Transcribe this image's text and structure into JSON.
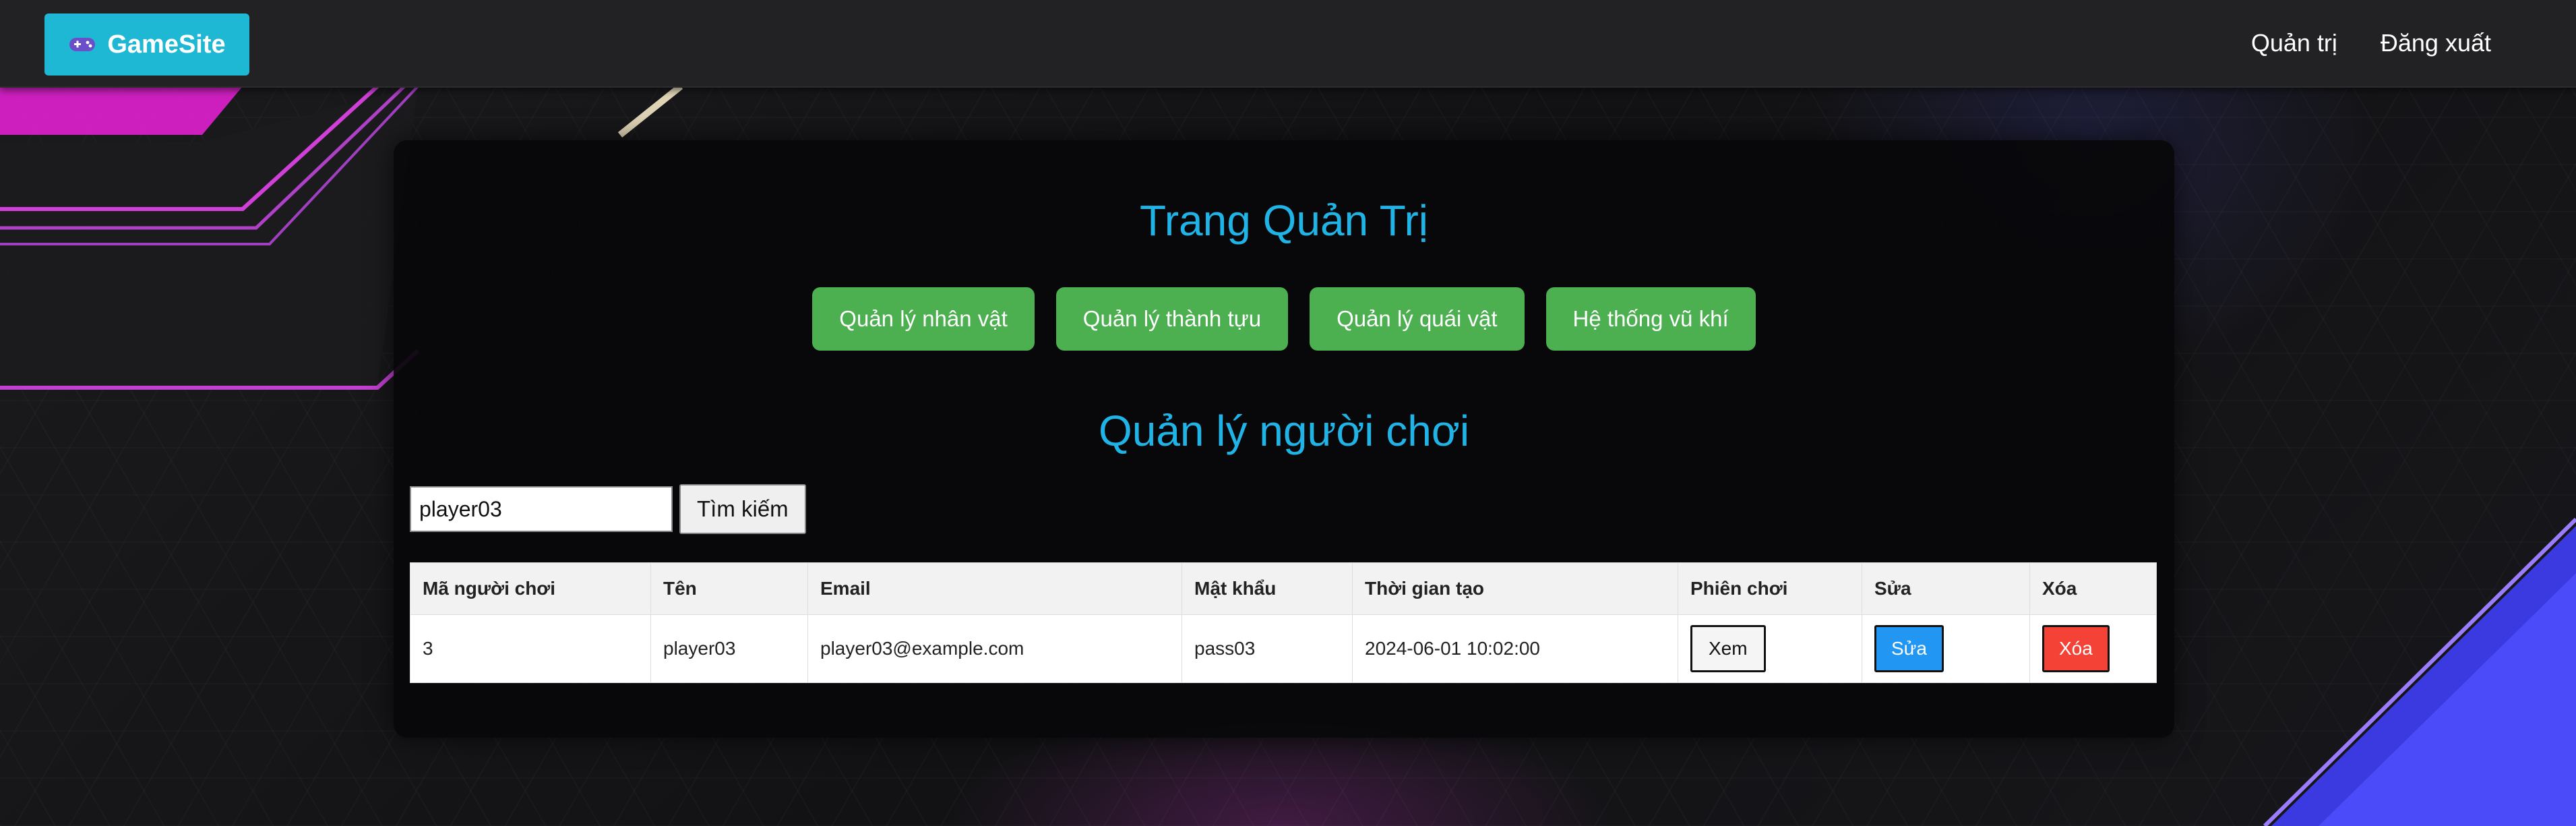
{
  "navbar": {
    "brand_label": "GameSite",
    "brand_icon": "gamepad-icon",
    "links": [
      "Quản trị",
      "Đăng xuất"
    ]
  },
  "admin": {
    "title": "Trang Quản Trị",
    "menu": [
      "Quản lý nhân vật",
      "Quản lý thành tựu",
      "Quản lý quái vật",
      "Hệ thống vũ khí"
    ]
  },
  "players": {
    "title": "Quản lý người chơi",
    "search": {
      "value": "player03",
      "button_label": "Tìm kiếm"
    },
    "columns": [
      "Mã người chơi",
      "Tên",
      "Email",
      "Mật khẩu",
      "Thời gian tạo",
      "Phiên chơi",
      "Sửa",
      "Xóa"
    ],
    "rows": [
      {
        "id": "3",
        "name": "player03",
        "email": "player03@example.com",
        "password": "pass03",
        "created": "2024-06-01 10:02:00",
        "view_label": "Xem",
        "edit_label": "Sửa",
        "delete_label": "Xóa"
      }
    ]
  },
  "colors": {
    "accent": "#1fb8d4",
    "title": "#1fb3e6",
    "menu_button": "#4caf50",
    "edit_button": "#2196f3",
    "delete_button": "#f44336",
    "navbar": "#222224"
  }
}
